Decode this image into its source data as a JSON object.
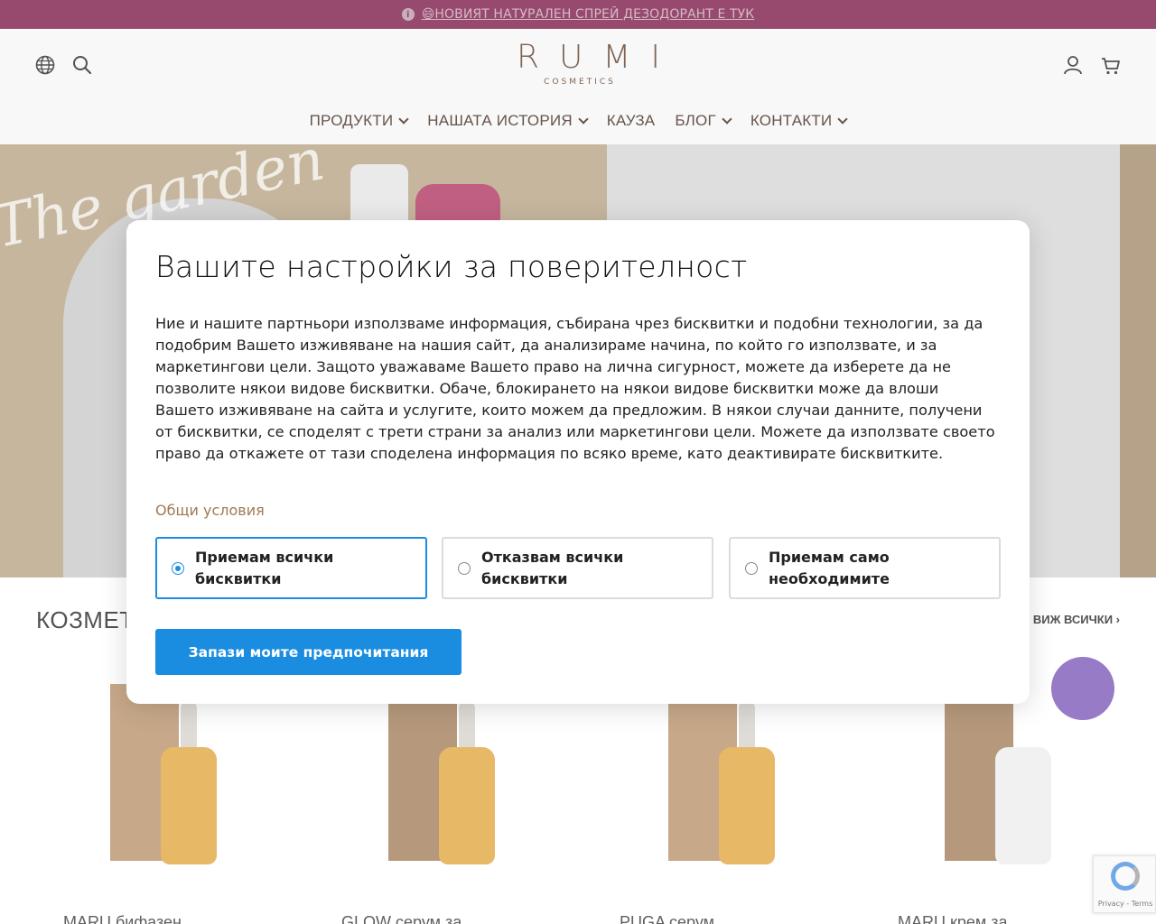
{
  "announcement": {
    "text": "😄НОВИЯТ НАТУРАЛЕН СПРЕЙ ДЕЗОДОРАНТ Е ТУК",
    "icon": "info-icon"
  },
  "header": {
    "logo_main": "RUMI",
    "logo_sub": "COSMETICS",
    "nav": [
      {
        "label": "ПРОДУКТИ",
        "has_dropdown": true
      },
      {
        "label": "НАШАТА ИСТОРИЯ",
        "has_dropdown": true
      },
      {
        "label": "КАУЗА",
        "has_dropdown": false
      },
      {
        "label": "БЛОГ",
        "has_dropdown": true
      },
      {
        "label": "КОНТАКТИ",
        "has_dropdown": true
      }
    ]
  },
  "hero": {
    "script_text": "The garden"
  },
  "products_section": {
    "title": "КОЗМЕТ",
    "view_all": "ВИЖ ВСИЧКИ ›",
    "products": [
      {
        "name": "MARU бифазен"
      },
      {
        "name": "GLOW серум за"
      },
      {
        "name": "PUGA серум"
      },
      {
        "name": "MARU крем за"
      }
    ]
  },
  "recaptcha": {
    "text": "Privacy - Terms"
  },
  "modal": {
    "title": "Вашите настройки за поверителност",
    "body": "Ние и нашите партньори използваме информация, събирана чрез бисквитки и подобни технологии, за да подобрим Вашето изживяване на нашия сайт, да анализираме начина, по който го използвате, и за маркетингови цели. Защото уважаваме Вашето право на лична сигурност, можете да изберете да не позволите някои видове бисквитки. Обаче, блокирането на някои видове бисквитки може да влоши Вашето изживяване на сайта и услугите, които можем да предложим. В някои случаи данните, получени от бисквитки, се споделят с трети страни за анализ или маркетингови цели. Можете да използвате своето право да откажете от тази споделена информация по всяко време, като деактивирате бисквитките.",
    "terms_link": "Общи условия",
    "options": [
      {
        "label": "Приемам всички бисквитки",
        "selected": true
      },
      {
        "label": "Отказвам всички бисквитки",
        "selected": false
      },
      {
        "label": "Приемам само необходимите",
        "selected": false
      }
    ],
    "save_button": "Запази моите предпочитания"
  },
  "colors": {
    "announcement_bg": "#7a1845",
    "accent_blue": "#1a8de0",
    "brand_brown": "#5b3a24",
    "terms_link": "#a07a52"
  }
}
